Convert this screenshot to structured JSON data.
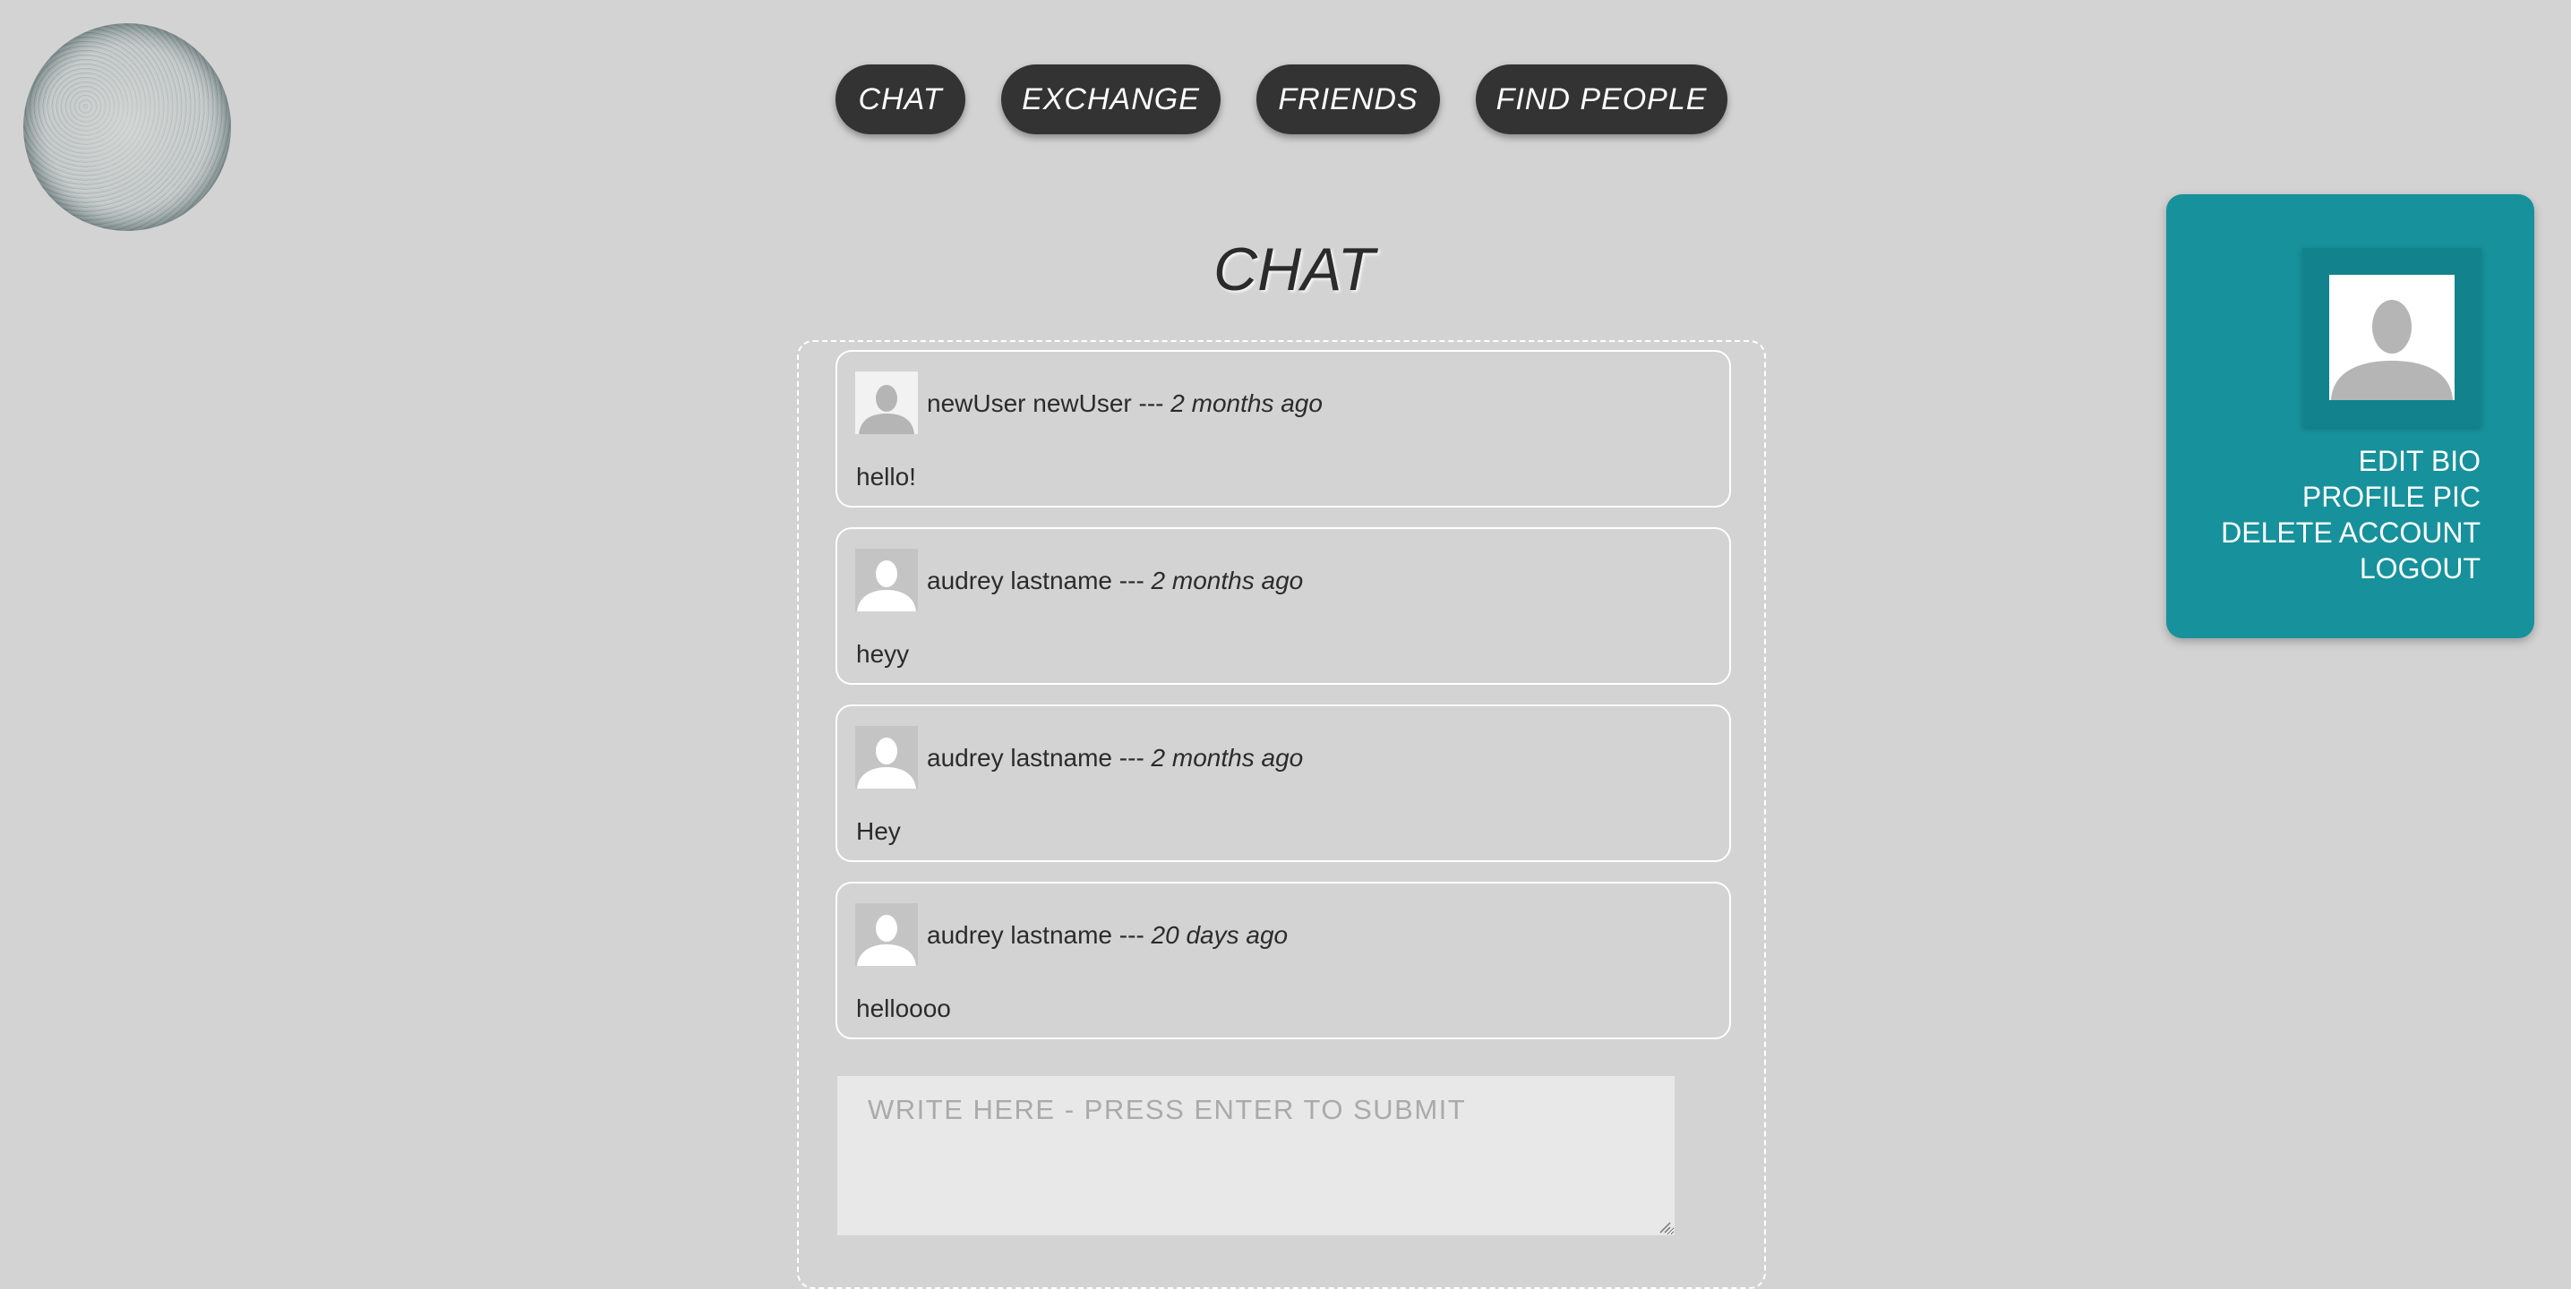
{
  "nav": {
    "items": [
      {
        "label": "CHAT"
      },
      {
        "label": "EXCHANGE"
      },
      {
        "label": "FRIENDS"
      },
      {
        "label": "FIND PEOPLE"
      }
    ]
  },
  "page": {
    "title": "CHAT"
  },
  "messages": [
    {
      "author": "newUser newUser",
      "separator": " --- ",
      "time": "2 months ago",
      "text": "hello!",
      "avatar_icon": "default-avatar-icon"
    },
    {
      "author": "audrey lastname",
      "separator": " --- ",
      "time": "2 months ago",
      "text": "heyy",
      "avatar_icon": "default-avatar-icon"
    },
    {
      "author": "audrey lastname",
      "separator": " --- ",
      "time": "2 months ago",
      "text": "Hey",
      "avatar_icon": "default-avatar-icon"
    },
    {
      "author": "audrey lastname",
      "separator": " --- ",
      "time": "20 days ago",
      "text": "helloooo",
      "avatar_icon": "default-avatar-icon"
    }
  ],
  "composer": {
    "placeholder": "WRITE HERE - PRESS ENTER TO SUBMIT",
    "value": ""
  },
  "profile": {
    "avatar_icon": "default-avatar-icon",
    "menu": [
      "EDIT BIO",
      "PROFILE PIC",
      "DELETE ACCOUNT",
      "LOGOUT"
    ]
  },
  "colors": {
    "background": "#d3d3d3",
    "nav_button": "#333333",
    "profile_panel": "#17919b",
    "composer": "#e8e8e8"
  }
}
